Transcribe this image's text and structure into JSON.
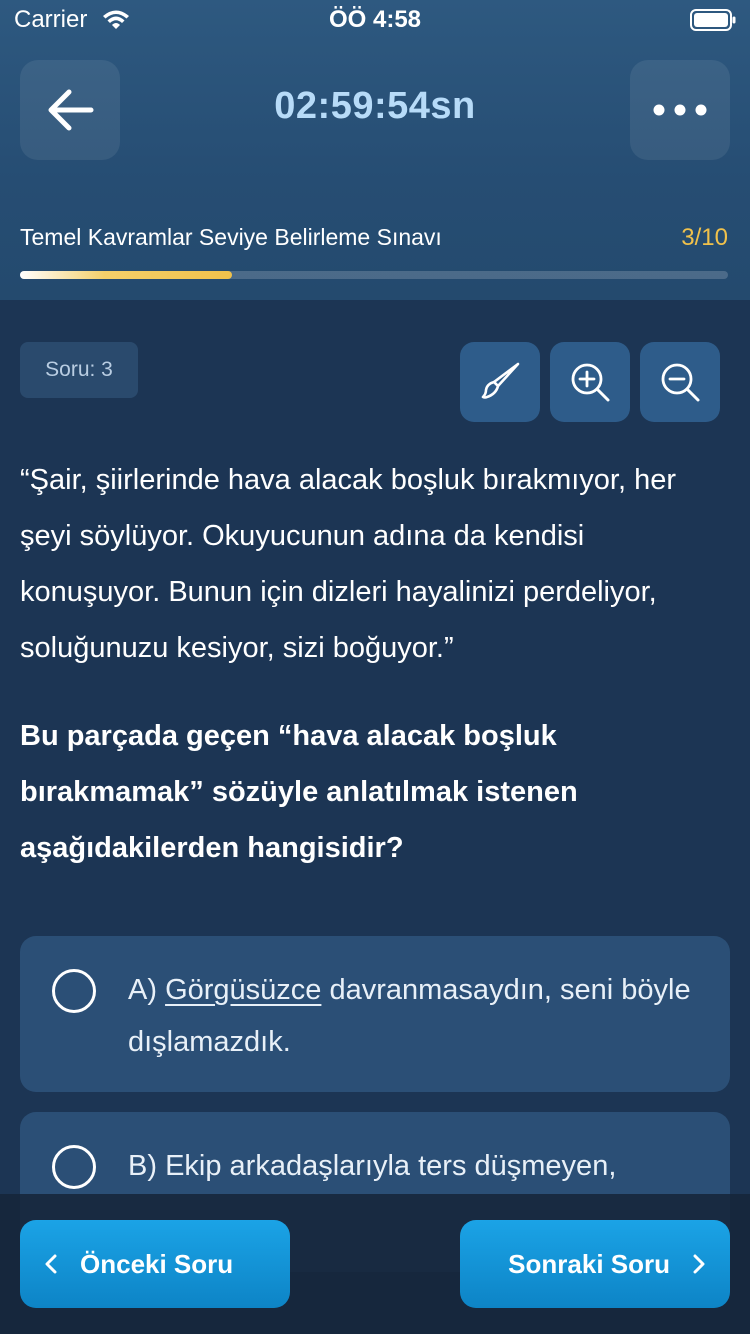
{
  "status_bar": {
    "carrier": "Carrier",
    "time": "ÖÖ 4:58"
  },
  "header": {
    "timer": "02:59:54sn",
    "exam_title": "Temel Kavramlar Seviye Belirleme Sınavı",
    "progress_text": "3/10",
    "progress_fraction": 0.3,
    "back_icon": "arrow-left-icon",
    "more_icon": "more-horizontal-icon"
  },
  "question": {
    "badge": "Soru: 3",
    "tools": [
      "brush-icon",
      "zoom-in-icon",
      "zoom-out-icon"
    ],
    "passage": "“Şair, şiirlerinde hava alacak boşluk bırakmıyor, her şeyi söylüyor. Okuyucunun adına da kendisi konuşuyor. Bunun için dizleri hayalinizi perdeliyor, soluğunuzu kesiyor, sizi boğuyor.”",
    "text": "Bu parçada geçen “hava alacak boşluk bırakmamak” sözüyle anlatılmak istenen aşağıdakilerden hangisidir?"
  },
  "options": [
    {
      "prefix": "A) ",
      "highlight": "Görgüsüzce",
      "rest": " davranmasaydın, seni böyle dışlamazdık."
    },
    {
      "prefix": "B) ",
      "highlight": "",
      "rest": "Ekip arkadaşlarıyla ters düşmeyen,"
    }
  ],
  "footer": {
    "prev_label": "Önceki Soru",
    "next_label": "Sonraki Soru"
  },
  "colors": {
    "background": "#1c3554",
    "header": "#2a5478",
    "timer": "#b7dbf8",
    "progress_accent": "#f0c14b",
    "tool_button": "#2e5c8a",
    "option_card": "#2b4f76",
    "footer_button": "#1296d8"
  }
}
